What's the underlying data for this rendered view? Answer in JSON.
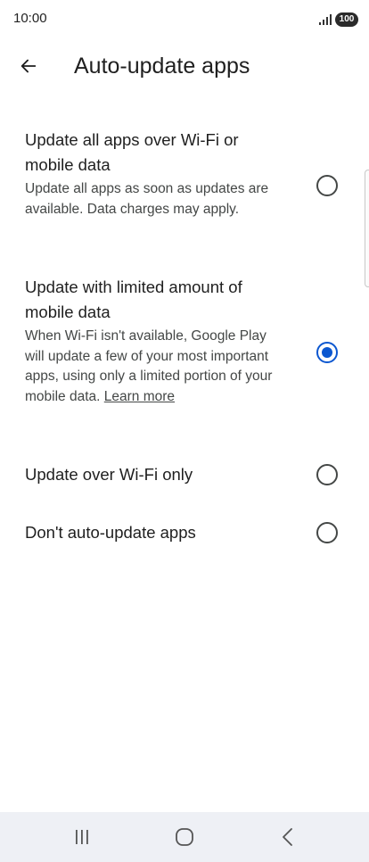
{
  "status_bar": {
    "time": "10:00",
    "battery": "100"
  },
  "header": {
    "back_icon": "arrow-back-icon",
    "title": "Auto-update apps"
  },
  "options": [
    {
      "title": "Update all apps over Wi-Fi or mobile data",
      "description": "Update all apps as soon as updates are available. Data charges may apply.",
      "selected": false
    },
    {
      "title": "Update with limited amount of mobile data",
      "description": "When Wi-Fi isn't available, Google Play will update a few of your most important apps, using only a limited portion of your mobile data.",
      "link": "Learn more",
      "selected": true
    },
    {
      "title": "Update over Wi-Fi only",
      "selected": false
    },
    {
      "title": "Don't auto-update apps",
      "selected": false
    }
  ],
  "nav_bar": {
    "recents_icon": "recents-icon",
    "home_icon": "home-icon",
    "back_icon": "nav-back-icon"
  },
  "colors": {
    "accent": "#0b57d0",
    "text_primary": "#1f1f1f",
    "text_secondary": "#444746",
    "nav_background": "#eef0f5"
  }
}
